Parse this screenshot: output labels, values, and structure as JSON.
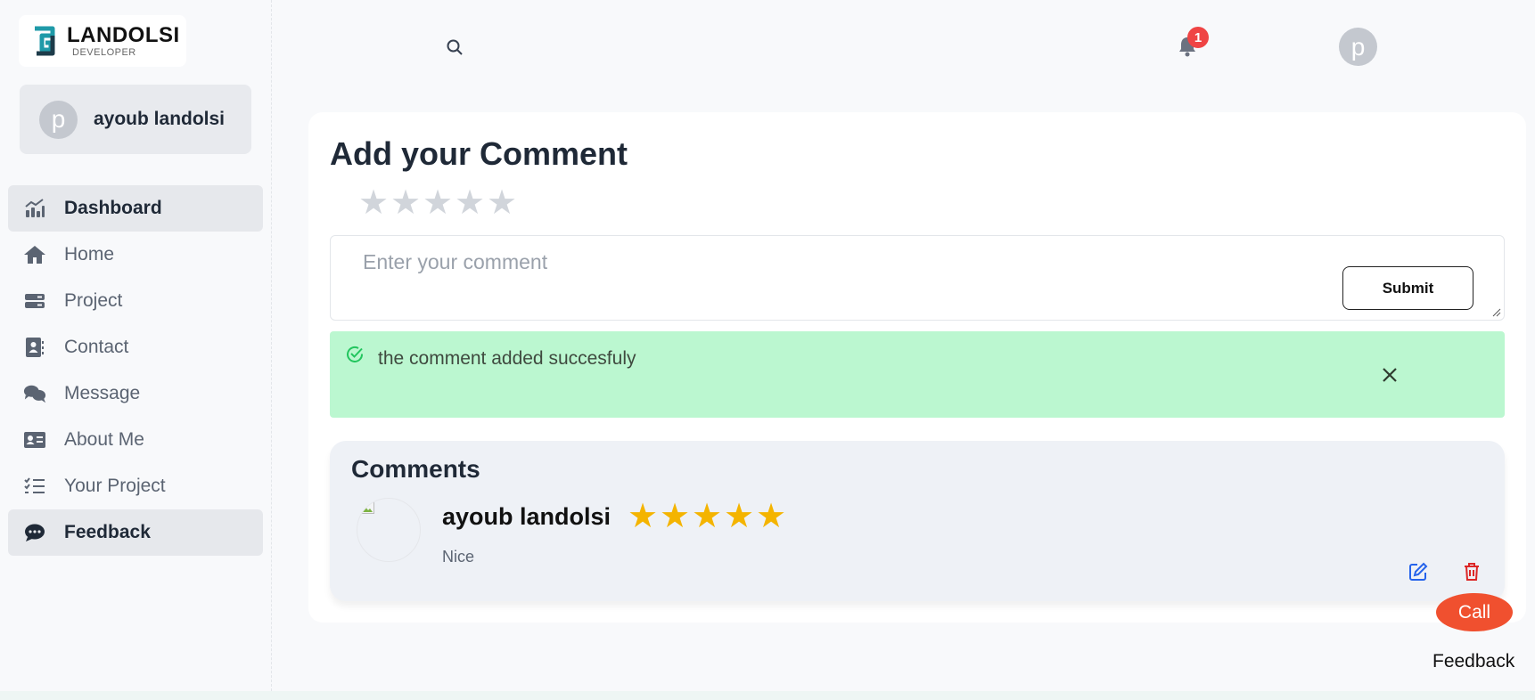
{
  "brand": {
    "name": "LANDOLSI",
    "tagline": "DEVELOPER",
    "colors": {
      "teal": "#1f9aa8",
      "dark": "#1d3b4a"
    }
  },
  "profile": {
    "avatar_letter": "p",
    "name": "ayoub landolsi"
  },
  "sidebar": {
    "items": [
      {
        "label": "Dashboard",
        "icon": "chart-icon",
        "active": true
      },
      {
        "label": "Home",
        "icon": "home-icon",
        "active": false
      },
      {
        "label": "Project",
        "icon": "server-icon",
        "active": false
      },
      {
        "label": "Contact",
        "icon": "contact-book-icon",
        "active": false
      },
      {
        "label": "Message",
        "icon": "chat-bubbles-icon",
        "active": false
      },
      {
        "label": "About Me",
        "icon": "id-card-icon",
        "active": false
      },
      {
        "label": "Your Project",
        "icon": "checklist-icon",
        "active": false
      },
      {
        "label": "Feedback",
        "icon": "comment-dots-icon",
        "active": true
      }
    ]
  },
  "topbar": {
    "notification_count": "1",
    "avatar_letter": "p"
  },
  "form": {
    "title": "Add your Comment",
    "rating": 0,
    "max_rating": 5,
    "placeholder": "Enter your comment",
    "submit_label": "Submit"
  },
  "alert": {
    "message": "the comment added succesfuly",
    "color": "#bbf7d0"
  },
  "comments": {
    "title": "Comments",
    "items": [
      {
        "author": "ayoub landolsi",
        "rating": 5,
        "text": "Nice"
      }
    ]
  },
  "floating": {
    "call_label": "Call",
    "feedback_label": "Feedback",
    "call_color": "#f0502f"
  },
  "colors": {
    "star_filled": "#f4b400",
    "star_empty": "#d1d5db",
    "badge": "#ef4444",
    "edit": "#2563eb",
    "delete": "#dc2626"
  }
}
